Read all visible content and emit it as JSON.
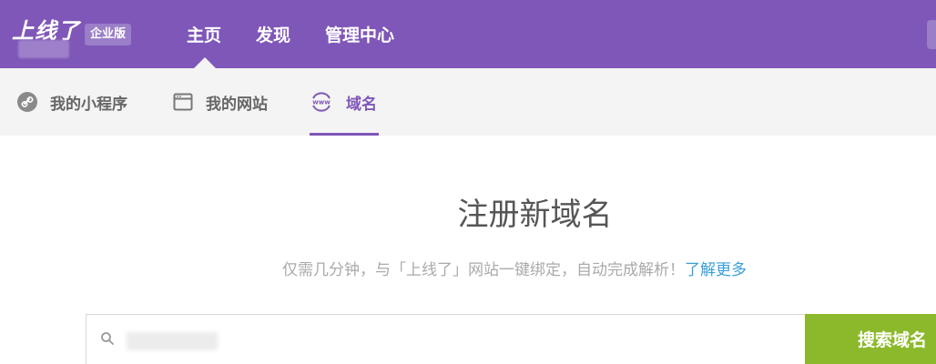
{
  "header": {
    "logo_text": "上线了",
    "edition_badge": "企业版",
    "nav": [
      "主页",
      "发现",
      "管理中心"
    ]
  },
  "subnav": {
    "tabs": [
      "我的小程序",
      "我的网站",
      "域名"
    ],
    "active_tab": "域名"
  },
  "main": {
    "title": "注册新域名",
    "subtitle": "仅需几分钟，与「上线了」网站一键绑定，自动完成解析！",
    "learn_more": "了解更多",
    "search_button": "搜索域名"
  },
  "colors": {
    "brand_purple": "#7f57b8",
    "subnav_bg": "#f4f4f4",
    "link_blue": "#3a9fd8",
    "button_green": "#8cb92b"
  },
  "icons": [
    "link-icon",
    "browser-window-icon",
    "www-globe-icon",
    "search-icon"
  ]
}
